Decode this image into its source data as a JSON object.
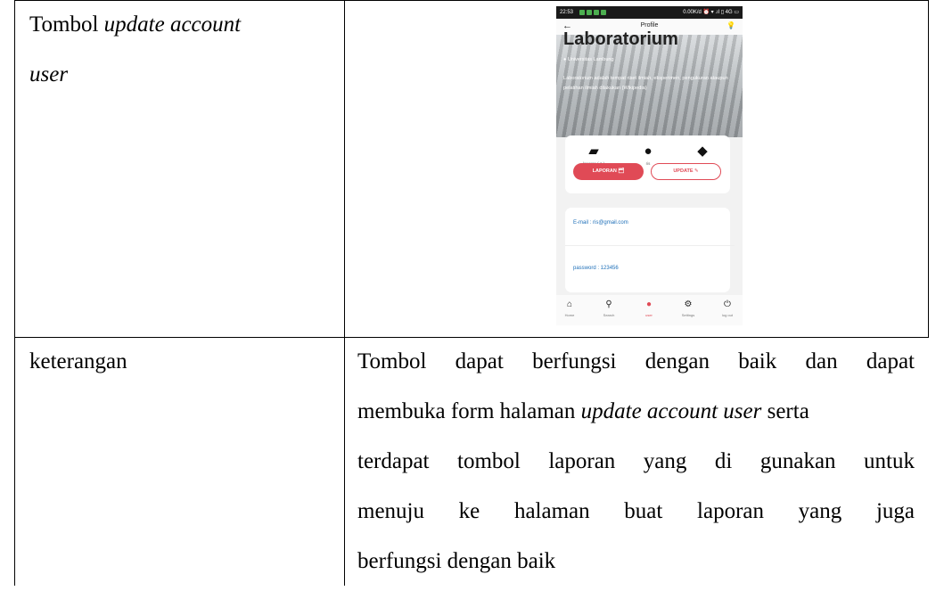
{
  "table": {
    "row1_label_plain": "Tombol ",
    "row1_label_italic_1": "update account",
    "row1_label_italic_2": "user",
    "row2_label": "keterangan",
    "row2_text": {
      "line1": "Tombol dapat berfungsi dengan baik dan dapat",
      "line2_a": "membuka form halaman ",
      "line2_italic": "update account user",
      "line2_b": " serta",
      "line3": "terdapat tombol laporan yang di gunakan untuk",
      "line4": "menuju ke halaman buat laporan yang juga",
      "line5": "berfungsi dengan baik"
    }
  },
  "phone": {
    "status": {
      "time": "22:53",
      "right": "0.00K/d ⏰ ▾ .ıl ▯ 4G ▭"
    },
    "appbar": {
      "back": "←",
      "title": "Profile",
      "bulb": "💡"
    },
    "hero": {
      "heading": "Laboratorium",
      "location": "Universitas Lambung",
      "description": "Laboratorium adalah tempat riset ilmiah, eksperimen, pengukuran ataupun pelatihan ilmiah dilakukan (Wikipedia)"
    },
    "stats": [
      {
        "icon": "folder-open-icon",
        "glyph": "📂",
        "label": "laporan ( 1 )"
      },
      {
        "icon": "user-icon",
        "glyph": "👤",
        "label": "ris"
      },
      {
        "icon": "graduation-cap-icon",
        "glyph": "🎓",
        "label": ""
      }
    ],
    "buttons": {
      "laporan": "LAPORAN 🗂",
      "update": "UPDATE ✎"
    },
    "info": {
      "email": "E-mail : ris@gmail.com",
      "password": "password : 123456"
    },
    "nav": [
      {
        "icon": "home-icon",
        "glyph": "⌂",
        "label": "Home",
        "active": false
      },
      {
        "icon": "search-icon",
        "glyph": "⌕",
        "label": "Search",
        "active": false
      },
      {
        "icon": "user-icon",
        "glyph": "👤",
        "label": "user",
        "active": true
      },
      {
        "icon": "gear-icon",
        "glyph": "⚙",
        "label": "Settings",
        "active": false
      },
      {
        "icon": "power-icon",
        "glyph": "⏻",
        "label": "log out",
        "active": false
      }
    ],
    "accent_color": "#e04a56",
    "link_color": "#1e6fb8"
  }
}
